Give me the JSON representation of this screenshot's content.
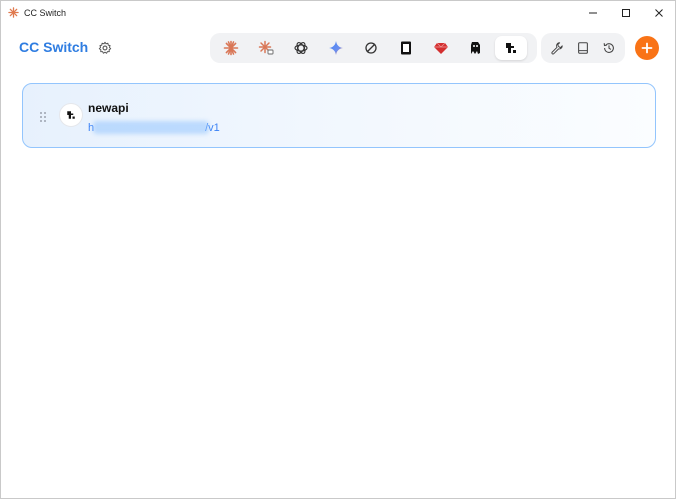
{
  "window": {
    "title": "CC Switch",
    "controls": [
      "minimize",
      "maximize",
      "close"
    ]
  },
  "header": {
    "brand": "CC Switch",
    "settings_icon": "gear-icon",
    "app_tabs": [
      {
        "icon": "claude-icon",
        "active": false
      },
      {
        "icon": "claude-desktop-icon",
        "active": false
      },
      {
        "icon": "openai-icon",
        "active": false
      },
      {
        "icon": "gemini-icon",
        "active": false
      },
      {
        "icon": "opencode-icon",
        "active": false
      },
      {
        "icon": "terminal-app-icon",
        "active": false
      },
      {
        "icon": "ruby-icon",
        "active": false
      },
      {
        "icon": "agent-icon",
        "active": false
      },
      {
        "icon": "newapi-icon",
        "active": true
      }
    ],
    "tool_buttons": [
      "wrench-icon",
      "book-icon",
      "history-icon"
    ],
    "add_icon": "plus-icon",
    "colors": {
      "brand": "#2f7de1",
      "add_button": "#f97316",
      "card_border": "#93c5fd"
    }
  },
  "providers": [
    {
      "name": "newapi",
      "url_start": "h",
      "url_end": "/v1",
      "active": true
    }
  ]
}
